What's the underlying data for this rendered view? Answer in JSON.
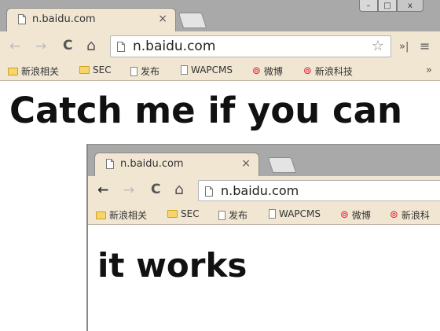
{
  "outer": {
    "tab": {
      "title": "n.baidu.com",
      "close": "×"
    },
    "window_controls": {
      "minimize": "–",
      "maximize": "□",
      "close": "x"
    },
    "toolbar": {
      "back": "←",
      "forward": "→",
      "reload": "C",
      "home": "⌂",
      "url": "n.baidu.com",
      "star": "☆",
      "extensions_more": "»|",
      "menu": "≡"
    },
    "bookmarks": {
      "items": [
        {
          "label": "新浪相关",
          "icon": "folder-icon"
        },
        {
          "label": "SEC",
          "icon": "folder-icon"
        },
        {
          "label": "发布",
          "icon": "page-icon"
        },
        {
          "label": "WAPCMS",
          "icon": "page-icon"
        },
        {
          "label": "微博",
          "icon": "weibo-icon"
        },
        {
          "label": "新浪科技",
          "icon": "weibo-icon"
        }
      ],
      "more": "»"
    },
    "content": {
      "heading": "Catch me if you can"
    }
  },
  "inner": {
    "tab": {
      "title": "n.baidu.com",
      "close": "×"
    },
    "toolbar": {
      "back": "←",
      "forward": "→",
      "reload": "C",
      "home": "⌂",
      "url": "n.baidu.com"
    },
    "bookmarks": {
      "items": [
        {
          "label": "新浪相关",
          "icon": "folder-icon"
        },
        {
          "label": "SEC",
          "icon": "folder-icon"
        },
        {
          "label": "发布",
          "icon": "page-icon"
        },
        {
          "label": "WAPCMS",
          "icon": "page-icon"
        },
        {
          "label": "微博",
          "icon": "weibo-icon"
        },
        {
          "label": "新浪科",
          "icon": "weibo-icon"
        }
      ]
    },
    "content": {
      "heading": "it works"
    }
  },
  "colors": {
    "chrome_frame": "#a9a9a9",
    "tab_background": "#f0e6d2",
    "weibo_red": "#e6162d",
    "folder_yellow": "#f7d56b"
  }
}
